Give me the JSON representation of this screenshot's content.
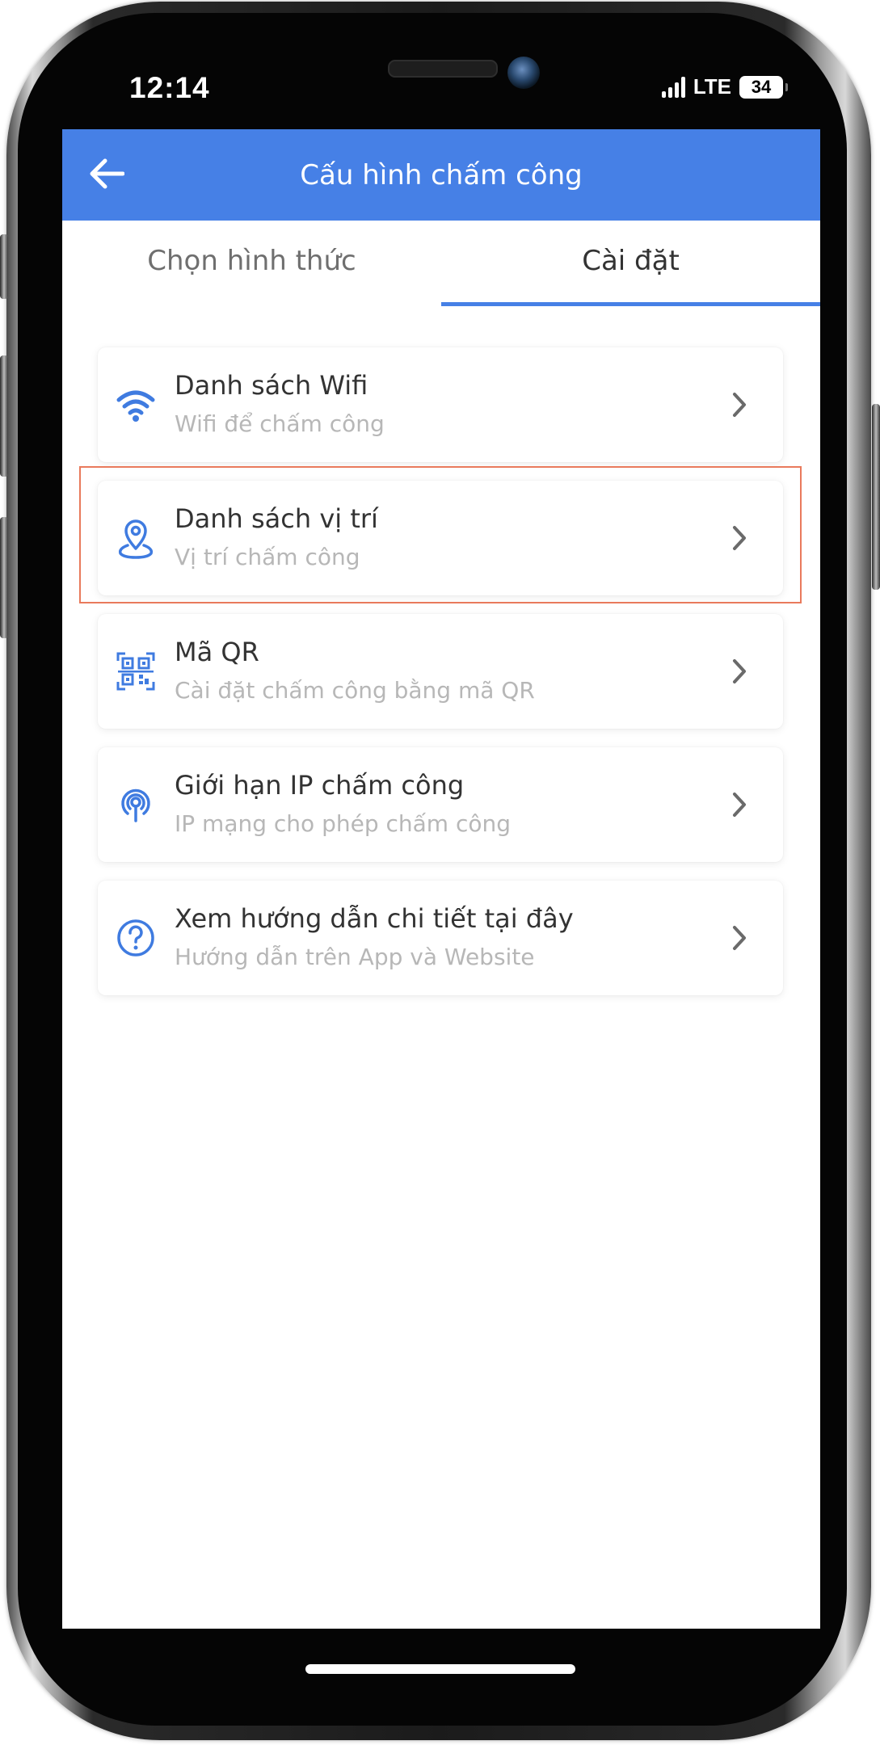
{
  "status_bar": {
    "time": "12:14",
    "network": "LTE",
    "battery": "34"
  },
  "header": {
    "title": "Cấu hình chấm công",
    "back_icon": "arrow-left-icon"
  },
  "tabs": [
    {
      "label": "Chọn hình thức",
      "active": false
    },
    {
      "label": "Cài đặt",
      "active": true
    }
  ],
  "items": [
    {
      "icon": "wifi-icon",
      "title": "Danh sách Wifi",
      "subtitle": "Wifi để chấm công"
    },
    {
      "icon": "location-pin-icon",
      "title": "Danh sách vị trí",
      "subtitle": "Vị trí chấm công"
    },
    {
      "icon": "qr-code-icon",
      "title": "Mã QR",
      "subtitle": "Cài đặt chấm công bằng mã QR"
    },
    {
      "icon": "broadcast-icon",
      "title": "Giới hạn IP chấm công",
      "subtitle": "IP mạng cho phép chấm công"
    },
    {
      "icon": "help-circle-icon",
      "title": "Xem hướng dẫn chi tiết tại đây",
      "subtitle": "Hướng dẫn trên App và Website"
    }
  ],
  "colors": {
    "primary": "#4680e6",
    "icon_blue": "#3f7be0",
    "highlight_border": "#e97a5c"
  }
}
